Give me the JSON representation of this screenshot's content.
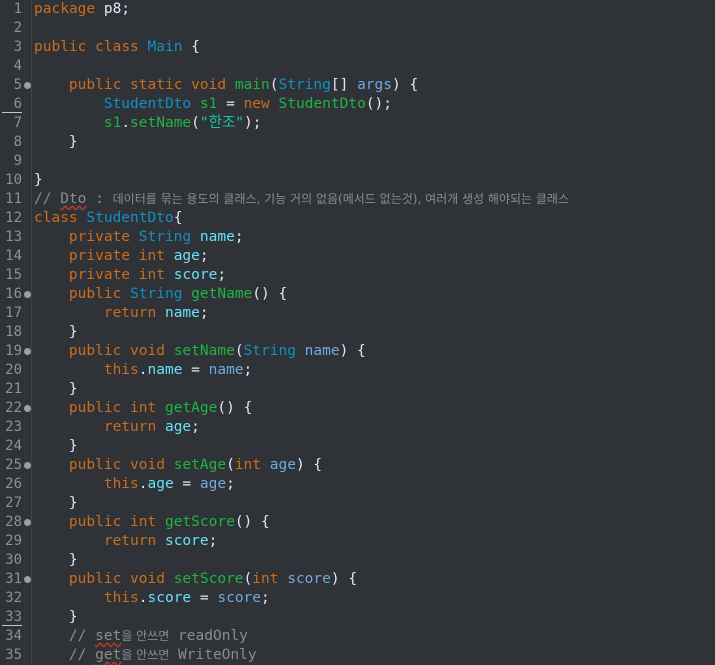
{
  "editor": {
    "language": "java",
    "background": "#2f3337",
    "lines": [
      {
        "n": "1",
        "fold": false,
        "tokens": [
          [
            "kw",
            "package"
          ],
          [
            "op",
            " p8;"
          ]
        ]
      },
      {
        "n": "2",
        "fold": false,
        "tokens": []
      },
      {
        "n": "3",
        "fold": false,
        "tokens": [
          [
            "kw",
            "public"
          ],
          [
            "op",
            " "
          ],
          [
            "kw",
            "class"
          ],
          [
            "op",
            " "
          ],
          [
            "ty",
            "Main"
          ],
          [
            "op",
            " {"
          ]
        ]
      },
      {
        "n": "4",
        "fold": false,
        "tokens": []
      },
      {
        "n": "5",
        "fold": true,
        "tokens": [
          [
            "op",
            "    "
          ],
          [
            "kw",
            "public"
          ],
          [
            "op",
            " "
          ],
          [
            "kw",
            "static"
          ],
          [
            "op",
            " "
          ],
          [
            "kw",
            "void"
          ],
          [
            "op",
            " "
          ],
          [
            "fn",
            "main"
          ],
          [
            "op",
            "("
          ],
          [
            "ty",
            "String"
          ],
          [
            "op",
            "[] "
          ],
          [
            "var",
            "args"
          ],
          [
            "op",
            ") {"
          ]
        ]
      },
      {
        "n": "6",
        "fold": false,
        "tokens": [
          [
            "op",
            "        "
          ],
          [
            "ty",
            "StudentDto"
          ],
          [
            "op",
            " "
          ],
          [
            "fn",
            "s1"
          ],
          [
            "op",
            " = "
          ],
          [
            "kw",
            "new"
          ],
          [
            "op",
            " "
          ],
          [
            "fn",
            "StudentDto"
          ],
          [
            "op",
            "();"
          ]
        ]
      },
      {
        "n": "7",
        "fold": false,
        "tokens": [
          [
            "op",
            "        "
          ],
          [
            "fn",
            "s1"
          ],
          [
            "op",
            "."
          ],
          [
            "fn",
            "setName"
          ],
          [
            "op",
            "("
          ],
          [
            "str",
            "\"한조\""
          ],
          [
            "op",
            ");"
          ]
        ]
      },
      {
        "n": "8",
        "fold": false,
        "tokens": [
          [
            "op",
            "    }"
          ]
        ]
      },
      {
        "n": "9",
        "fold": false,
        "tokens": []
      },
      {
        "n": "10",
        "fold": false,
        "tokens": [
          [
            "op",
            "}"
          ]
        ]
      },
      {
        "n": "11",
        "fold": false,
        "tokens": [
          [
            "cm",
            "// "
          ],
          [
            "cm sq",
            "Dto"
          ],
          [
            "cm",
            " : "
          ],
          [
            "cm-k",
            "데이터를 묶는 용도의 클래스, 기능 거의 없음(메서드 없는것), 여러개 생성 해야되는 클래스"
          ]
        ]
      },
      {
        "n": "12",
        "fold": false,
        "tokens": [
          [
            "kw",
            "class"
          ],
          [
            "op",
            " "
          ],
          [
            "ty",
            "StudentDto"
          ],
          [
            "op",
            "{"
          ]
        ]
      },
      {
        "n": "13",
        "fold": false,
        "tokens": [
          [
            "op",
            "    "
          ],
          [
            "kw",
            "private"
          ],
          [
            "op",
            " "
          ],
          [
            "ty",
            "String"
          ],
          [
            "op",
            " "
          ],
          [
            "fld",
            "name"
          ],
          [
            "op",
            ";"
          ]
        ]
      },
      {
        "n": "14",
        "fold": false,
        "tokens": [
          [
            "op",
            "    "
          ],
          [
            "kw",
            "private"
          ],
          [
            "op",
            " "
          ],
          [
            "kw",
            "int"
          ],
          [
            "op",
            " "
          ],
          [
            "fld",
            "age"
          ],
          [
            "op",
            ";"
          ]
        ]
      },
      {
        "n": "15",
        "fold": false,
        "tokens": [
          [
            "op",
            "    "
          ],
          [
            "kw",
            "private"
          ],
          [
            "op",
            " "
          ],
          [
            "kw",
            "int"
          ],
          [
            "op",
            " "
          ],
          [
            "fld",
            "score"
          ],
          [
            "op",
            ";"
          ]
        ]
      },
      {
        "n": "16",
        "fold": true,
        "tokens": [
          [
            "op",
            "    "
          ],
          [
            "kw",
            "public"
          ],
          [
            "op",
            " "
          ],
          [
            "ty",
            "String"
          ],
          [
            "op",
            " "
          ],
          [
            "fn",
            "getName"
          ],
          [
            "op",
            "() {"
          ]
        ]
      },
      {
        "n": "17",
        "fold": false,
        "tokens": [
          [
            "op",
            "        "
          ],
          [
            "kw",
            "return"
          ],
          [
            "op",
            " "
          ],
          [
            "fld",
            "name"
          ],
          [
            "op",
            ";"
          ]
        ]
      },
      {
        "n": "18",
        "fold": false,
        "tokens": [
          [
            "op",
            "    }"
          ]
        ]
      },
      {
        "n": "19",
        "fold": true,
        "tokens": [
          [
            "op",
            "    "
          ],
          [
            "kw",
            "public"
          ],
          [
            "op",
            " "
          ],
          [
            "kw",
            "void"
          ],
          [
            "op",
            " "
          ],
          [
            "fn",
            "setName"
          ],
          [
            "op",
            "("
          ],
          [
            "ty",
            "String"
          ],
          [
            "op",
            " "
          ],
          [
            "var",
            "name"
          ],
          [
            "op",
            ") {"
          ]
        ]
      },
      {
        "n": "20",
        "fold": false,
        "tokens": [
          [
            "op",
            "        "
          ],
          [
            "kw",
            "this"
          ],
          [
            "op",
            "."
          ],
          [
            "fld",
            "name"
          ],
          [
            "op",
            " = "
          ],
          [
            "var",
            "name"
          ],
          [
            "op",
            ";"
          ]
        ]
      },
      {
        "n": "21",
        "fold": false,
        "tokens": [
          [
            "op",
            "    }"
          ]
        ]
      },
      {
        "n": "22",
        "fold": true,
        "tokens": [
          [
            "op",
            "    "
          ],
          [
            "kw",
            "public"
          ],
          [
            "op",
            " "
          ],
          [
            "kw",
            "int"
          ],
          [
            "op",
            " "
          ],
          [
            "fn",
            "getAge"
          ],
          [
            "op",
            "() {"
          ]
        ]
      },
      {
        "n": "23",
        "fold": false,
        "tokens": [
          [
            "op",
            "        "
          ],
          [
            "kw",
            "return"
          ],
          [
            "op",
            " "
          ],
          [
            "fld",
            "age"
          ],
          [
            "op",
            ";"
          ]
        ]
      },
      {
        "n": "24",
        "fold": false,
        "tokens": [
          [
            "op",
            "    }"
          ]
        ]
      },
      {
        "n": "25",
        "fold": true,
        "tokens": [
          [
            "op",
            "    "
          ],
          [
            "kw",
            "public"
          ],
          [
            "op",
            " "
          ],
          [
            "kw",
            "void"
          ],
          [
            "op",
            " "
          ],
          [
            "fn",
            "setAge"
          ],
          [
            "op",
            "("
          ],
          [
            "kw",
            "int"
          ],
          [
            "op",
            " "
          ],
          [
            "var",
            "age"
          ],
          [
            "op",
            ") {"
          ]
        ]
      },
      {
        "n": "26",
        "fold": false,
        "tokens": [
          [
            "op",
            "        "
          ],
          [
            "kw",
            "this"
          ],
          [
            "op",
            "."
          ],
          [
            "fld",
            "age"
          ],
          [
            "op",
            " = "
          ],
          [
            "var",
            "age"
          ],
          [
            "op",
            ";"
          ]
        ]
      },
      {
        "n": "27",
        "fold": false,
        "tokens": [
          [
            "op",
            "    }"
          ]
        ]
      },
      {
        "n": "28",
        "fold": true,
        "tokens": [
          [
            "op",
            "    "
          ],
          [
            "kw",
            "public"
          ],
          [
            "op",
            " "
          ],
          [
            "kw",
            "int"
          ],
          [
            "op",
            " "
          ],
          [
            "fn",
            "getScore"
          ],
          [
            "op",
            "() {"
          ]
        ]
      },
      {
        "n": "29",
        "fold": false,
        "tokens": [
          [
            "op",
            "        "
          ],
          [
            "kw",
            "return"
          ],
          [
            "op",
            " "
          ],
          [
            "fld",
            "score"
          ],
          [
            "op",
            ";"
          ]
        ]
      },
      {
        "n": "30",
        "fold": false,
        "tokens": [
          [
            "op",
            "    }"
          ]
        ]
      },
      {
        "n": "31",
        "fold": true,
        "tokens": [
          [
            "op",
            "    "
          ],
          [
            "kw",
            "public"
          ],
          [
            "op",
            " "
          ],
          [
            "kw",
            "void"
          ],
          [
            "op",
            " "
          ],
          [
            "fn",
            "setScore"
          ],
          [
            "op",
            "("
          ],
          [
            "kw",
            "int"
          ],
          [
            "op",
            " "
          ],
          [
            "var",
            "score"
          ],
          [
            "op",
            ") {"
          ]
        ]
      },
      {
        "n": "32",
        "fold": false,
        "tokens": [
          [
            "op",
            "        "
          ],
          [
            "kw",
            "this"
          ],
          [
            "op",
            "."
          ],
          [
            "fld",
            "score"
          ],
          [
            "op",
            " = "
          ],
          [
            "var",
            "score"
          ],
          [
            "op",
            ";"
          ]
        ]
      },
      {
        "n": "33",
        "fold": false,
        "tokens": [
          [
            "op",
            "    }"
          ]
        ]
      },
      {
        "n": "34",
        "fold": false,
        "tokens": [
          [
            "op",
            "    "
          ],
          [
            "cm",
            "// "
          ],
          [
            "cm sq",
            "set"
          ],
          [
            "cm-k",
            "을 안쓰면"
          ],
          [
            "cm",
            " readOnly"
          ]
        ]
      },
      {
        "n": "35",
        "fold": false,
        "tokens": [
          [
            "op",
            "    "
          ],
          [
            "cm",
            "// "
          ],
          [
            "cm sq",
            "get"
          ],
          [
            "cm-k",
            "을 안쓰면"
          ],
          [
            "cm",
            " WriteOnly"
          ]
        ]
      }
    ]
  }
}
